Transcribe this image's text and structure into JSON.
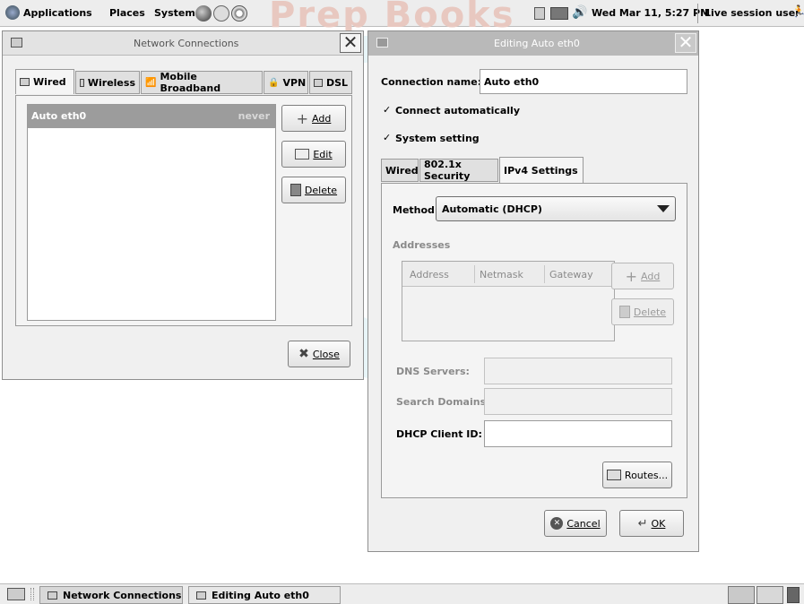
{
  "top_panel": {
    "menus": [
      "Applications",
      "Places",
      "System"
    ],
    "clock": "Wed Mar 11,  5:27 PM",
    "user": "Live session user"
  },
  "watermark": "Prep Books",
  "network_window": {
    "title": "Network Connections",
    "tabs": [
      "Wired",
      "Wireless",
      "Mobile Broadband",
      "VPN",
      "DSL"
    ],
    "connections": [
      {
        "name": "Auto eth0",
        "last_used": "never"
      }
    ],
    "buttons": {
      "add": "Add",
      "edit": "Edit",
      "delete": "Delete",
      "close": "Close"
    }
  },
  "edit_window": {
    "title": "Editing Auto eth0",
    "connection_name_label": "Connection name:",
    "connection_name_value": "Auto eth0",
    "connect_automatically": {
      "label": "Connect automatically",
      "checked": true
    },
    "system_setting": {
      "label": "System setting",
      "checked": true
    },
    "tabs": [
      "Wired",
      "802.1x Security",
      "IPv4 Settings"
    ],
    "selected_tab": "IPv4 Settings",
    "method_label": "Method:",
    "method_value": "Automatic (DHCP)",
    "addresses_label": "Addresses",
    "address_columns": [
      "Address",
      "Netmask",
      "Gateway"
    ],
    "address_buttons": {
      "add": "Add",
      "delete": "Delete"
    },
    "dns_servers_label": "DNS Servers:",
    "search_domains_label": "Search Domains:",
    "dhcp_client_id_label": "DHCP Client ID:",
    "routes_button": "Routes...",
    "cancel_button": "Cancel",
    "ok_button": "OK"
  },
  "taskbar": {
    "tasks": [
      "Network Connections",
      "Editing Auto eth0"
    ]
  }
}
